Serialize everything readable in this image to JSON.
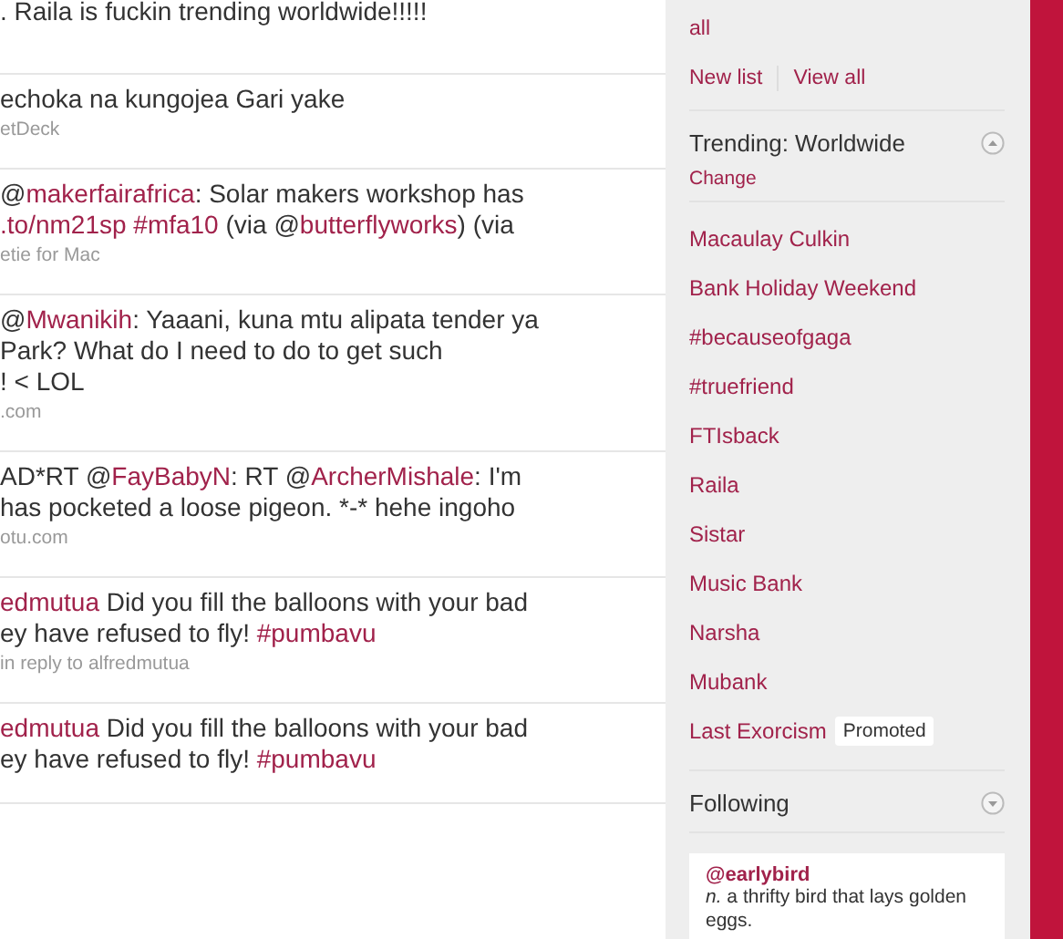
{
  "timeline": [
    {
      "lines": [
        [
          {
            "text": ". Raila is fuckin trending worldwide!!!!!",
            "link": false
          }
        ]
      ]
    },
    {
      "lines": [
        [
          {
            "text": "echoka na kungojea Gari yake",
            "link": false
          }
        ]
      ],
      "meta": "etDeck"
    },
    {
      "lines": [
        [
          {
            "text": "@",
            "link": false
          },
          {
            "text": "makerfairafrica",
            "link": true
          },
          {
            "text": ": Solar makers workshop has",
            "link": false
          }
        ],
        [
          {
            "text": ".to/nm21sp #mfa10",
            "link": true
          },
          {
            "text": " (via @",
            "link": false
          },
          {
            "text": "butterflyworks",
            "link": true
          },
          {
            "text": ") (via",
            "link": false
          }
        ]
      ],
      "meta": "etie for Mac"
    },
    {
      "lines": [
        [
          {
            "text": "@",
            "link": false
          },
          {
            "text": "Mwanikih",
            "link": true
          },
          {
            "text": ": Yaaani, kuna mtu alipata tender ya",
            "link": false
          }
        ],
        [
          {
            "text": "Park? What do I need to do to get such",
            "link": false
          }
        ],
        [
          {
            "text": "! < LOL",
            "link": false
          }
        ]
      ],
      "meta": ".com"
    },
    {
      "lines": [
        [
          {
            "text": "AD*RT @",
            "link": false
          },
          {
            "text": "FayBabyN",
            "link": true
          },
          {
            "text": ": RT @",
            "link": false
          },
          {
            "text": "ArcherMishale",
            "link": true
          },
          {
            "text": ": I'm",
            "link": false
          }
        ],
        [
          {
            "text": "has pocketed a loose pigeon. *-* hehe ingoho",
            "link": false
          }
        ]
      ],
      "meta": "otu.com"
    },
    {
      "lines": [
        [
          {
            "text": "edmutua",
            "link": true
          },
          {
            "text": " Did you fill the balloons with your bad",
            "link": false
          }
        ],
        [
          {
            "text": "ey have refused to fly! ",
            "link": false
          },
          {
            "text": "#pumbavu",
            "link": true
          }
        ]
      ],
      "meta": "in reply to alfredmutua"
    },
    {
      "lines": [
        [
          {
            "text": "edmutua",
            "link": true
          },
          {
            "text": " Did you fill the balloons with your bad",
            "link": false
          }
        ],
        [
          {
            "text": "ey have refused to fly! ",
            "link": false
          },
          {
            "text": "#pumbavu",
            "link": true
          }
        ]
      ]
    }
  ],
  "sidebar": {
    "lists_link": "all",
    "list_actions": [
      "New list",
      "View all"
    ],
    "trending": {
      "title": "Trending: Worldwide",
      "expanded": true,
      "change": "Change",
      "topics": [
        {
          "label": "Macaulay Culkin"
        },
        {
          "label": "Bank Holiday Weekend"
        },
        {
          "label": "#becauseofgaga"
        },
        {
          "label": "#truefriend"
        },
        {
          "label": "FTIsback"
        },
        {
          "label": "Raila"
        },
        {
          "label": "Sistar"
        },
        {
          "label": "Music Bank"
        },
        {
          "label": "Narsha"
        },
        {
          "label": "Mubank"
        },
        {
          "label": "Last Exorcism",
          "badge": "Promoted"
        }
      ]
    },
    "following": {
      "title": "Following",
      "expanded": false
    },
    "card": {
      "handle": "@earlybird",
      "definition": "*n.* a thrifty bird that lays golden eggs."
    }
  }
}
